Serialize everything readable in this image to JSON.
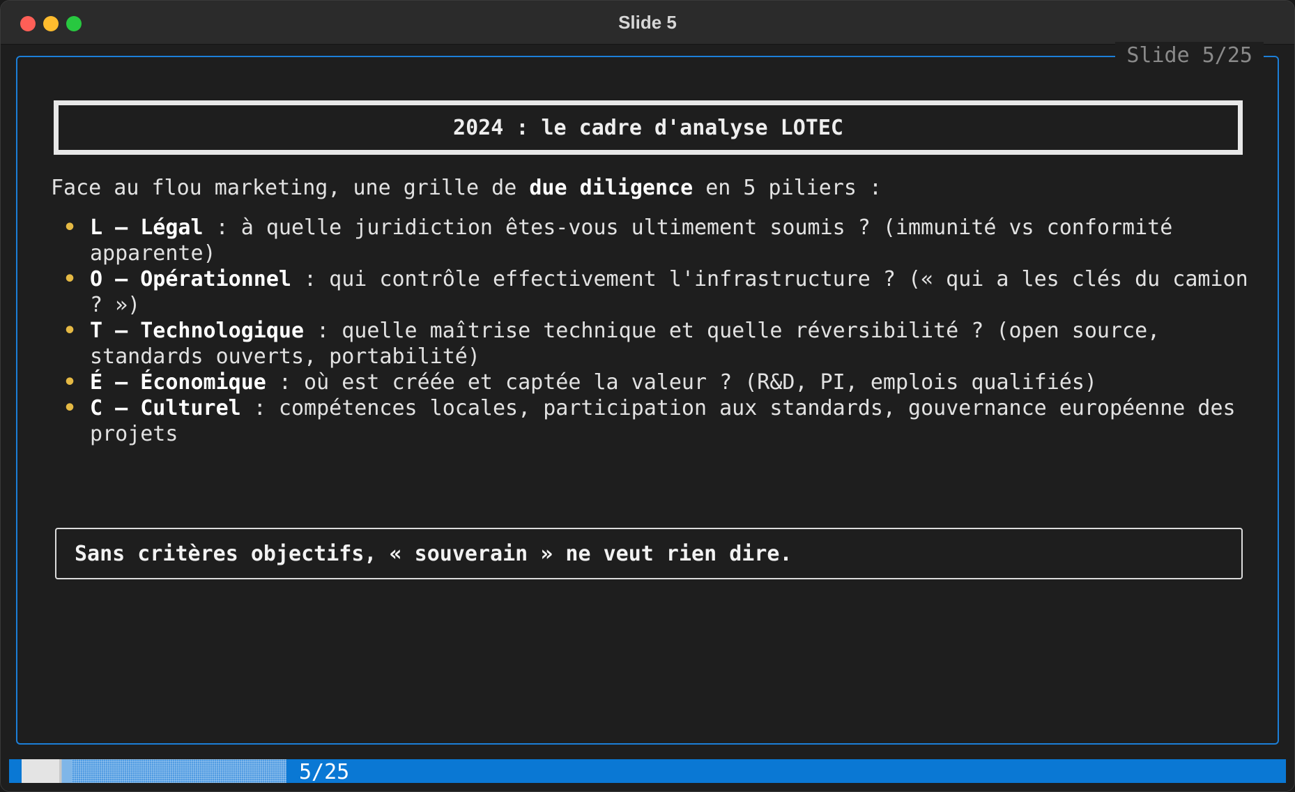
{
  "window": {
    "title": "Slide 5"
  },
  "frame": {
    "label": "Slide 5/25"
  },
  "slide": {
    "heading": "2024 : le cadre d'analyse LOTEC",
    "intro_before": "Face au flou marketing, une grille de ",
    "intro_bold": "due diligence",
    "intro_after": " en 5 piliers :",
    "bullet_char": "•",
    "pillars": [
      {
        "key": "L — Légal",
        "text": " : à quelle juridiction êtes-vous ultimement soumis ? (immunité vs conformité apparente)"
      },
      {
        "key": "O — Opérationnel",
        "text": " : qui contrôle effectivement l'infrastructure ? (« qui a les clés du camion ? »)"
      },
      {
        "key": "T — Technologique",
        "text": " : quelle maîtrise technique et quelle réversibilité ? (open source, standards ouverts, portabilité)"
      },
      {
        "key": "É — Économique",
        "text": " : où est créée et captée la valeur ? (R&D, PI, emplois qualifiés)"
      },
      {
        "key": "C — Culturel",
        "text": " : compétences locales, participation aux standards, gouvernance européenne des projets"
      }
    ],
    "callout": "Sans critères objectifs, « souverain » ne veut rien dire."
  },
  "status": {
    "progress_text": "5/25",
    "current": 5,
    "total": 25
  },
  "colors": {
    "frame_border": "#1c7fd8",
    "status_bar": "#0a78d4",
    "bullet": "#e5b944",
    "background": "#1e1e1e"
  }
}
